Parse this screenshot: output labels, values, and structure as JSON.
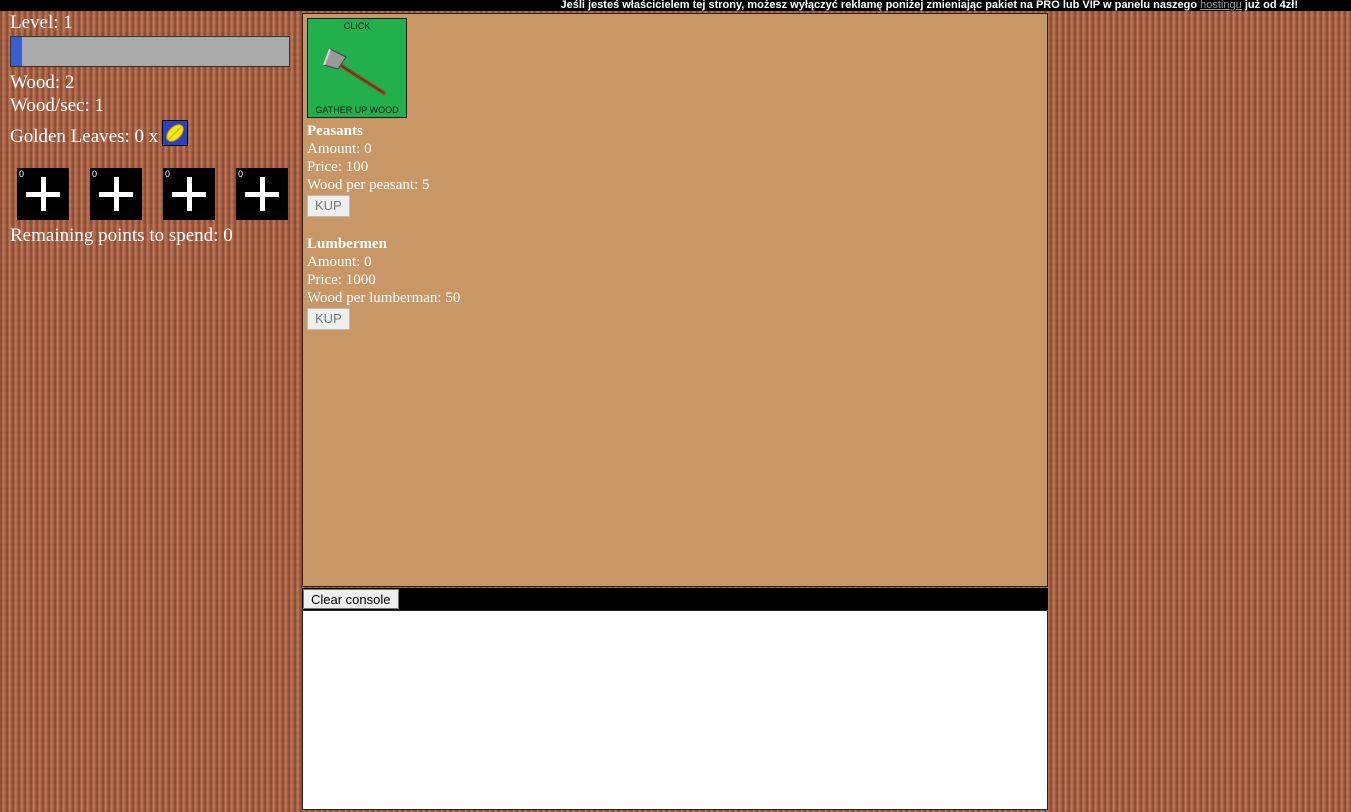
{
  "ad": {
    "text_before": "Jeśli jesteś właścicielem tej strony, możesz wyłączyć reklamę poniżej zmieniając pakiet na PRO lub VIP w panelu naszego ",
    "link": "hostingu",
    "text_after": " już od 4zł!"
  },
  "stats": {
    "level": "Level: 1",
    "level_progress": 0.04,
    "wood": "Wood: 2",
    "wood_per_sec": "Wood/sec: 1",
    "golden_leaves": "Golden Leaves: 0 x",
    "golden_leaf_icon": "golden-leaf-icon"
  },
  "skills": [
    {
      "count": "0",
      "icon": "plus-icon"
    },
    {
      "count": "0",
      "icon": "plus-icon"
    },
    {
      "count": "0",
      "icon": "plus-icon"
    },
    {
      "count": "0",
      "icon": "plus-icon"
    }
  ],
  "remaining_points": "Remaining points to spend: 0",
  "click": {
    "top_label": "CLICK",
    "bottom_label": "GATHER UP WOOD",
    "icon": "axe-icon"
  },
  "shop": {
    "peasants": {
      "title": "Peasants",
      "amount": "Amount: 0",
      "price": "Price: 100",
      "yield": "Wood per peasant: 5",
      "buy": "KUP"
    },
    "lumbermen": {
      "title": "Lumbermen",
      "amount": "Amount: 0",
      "price": "Price: 1000",
      "yield": "Wood per lumberman: 50",
      "buy": "KUP"
    }
  },
  "console": {
    "clear_label": "Clear console"
  },
  "colors": {
    "xp_fill": "#3a5fcd",
    "click_bg": "#22b04c",
    "main_bg": "#c99665"
  }
}
